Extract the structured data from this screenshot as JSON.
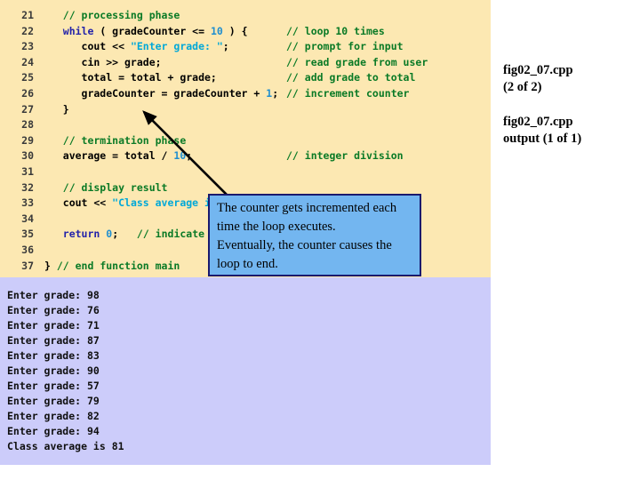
{
  "colors": {
    "code_background": "#fce8b2",
    "output_background": "#ccccfa",
    "callout_background": "#73b6f0",
    "callout_border": "#1a1a6e",
    "comment": "#0a7a26",
    "keyword": "#2222aa",
    "string": "#00a8d8",
    "number": "#1f8ecf",
    "line_number": "#3a3a3a",
    "code_text": "#000000"
  },
  "code_panel": {
    "lines": [
      {
        "no": "21",
        "indent": 0,
        "segments": [
          {
            "t": "   // processing phase",
            "c": "cmt"
          }
        ]
      },
      {
        "no": "22",
        "indent": 0,
        "segments": [
          {
            "t": "   ",
            "c": ""
          },
          {
            "t": "while",
            "c": "kw"
          },
          {
            "t": " ( gradeCounter <= ",
            "c": ""
          },
          {
            "t": "10",
            "c": "num"
          },
          {
            "t": " ) {",
            "c": ""
          }
        ]
      },
      {
        "no": "23",
        "indent": 0,
        "segments": [
          {
            "t": "      cout << ",
            "c": ""
          },
          {
            "t": "\"Enter grade: \"",
            "c": "str"
          },
          {
            "t": ";",
            "c": ""
          }
        ]
      },
      {
        "no": "24",
        "indent": 0,
        "segments": [
          {
            "t": "      cin >> grade;",
            "c": ""
          }
        ]
      },
      {
        "no": "25",
        "indent": 0,
        "segments": [
          {
            "t": "      total = total + grade;",
            "c": ""
          }
        ]
      },
      {
        "no": "26",
        "indent": 0,
        "segments": [
          {
            "t": "      gradeCounter = gradeCounter + ",
            "c": ""
          },
          {
            "t": "1",
            "c": "num"
          },
          {
            "t": ";",
            "c": ""
          }
        ]
      },
      {
        "no": "27",
        "indent": 0,
        "segments": [
          {
            "t": "   }",
            "c": ""
          }
        ]
      },
      {
        "no": "28",
        "indent": 0,
        "segments": [
          {
            "t": "",
            "c": ""
          }
        ]
      },
      {
        "no": "29",
        "indent": 0,
        "segments": [
          {
            "t": "   // termination phase",
            "c": "cmt"
          }
        ]
      },
      {
        "no": "30",
        "indent": 0,
        "segments": [
          {
            "t": "   average = total / ",
            "c": ""
          },
          {
            "t": "10",
            "c": "num"
          },
          {
            "t": ";",
            "c": ""
          }
        ]
      },
      {
        "no": "31",
        "indent": 0,
        "segments": [
          {
            "t": "",
            "c": ""
          }
        ]
      },
      {
        "no": "32",
        "indent": 0,
        "segments": [
          {
            "t": "   // display result",
            "c": "cmt"
          }
        ]
      },
      {
        "no": "33",
        "indent": 0,
        "segments": [
          {
            "t": "   cout << ",
            "c": ""
          },
          {
            "t": "\"Class average is\"",
            "c": "str"
          }
        ]
      },
      {
        "no": "34",
        "indent": 0,
        "segments": [
          {
            "t": "",
            "c": ""
          }
        ]
      },
      {
        "no": "35",
        "indent": 0,
        "segments": [
          {
            "t": "   ",
            "c": ""
          },
          {
            "t": "return",
            "c": "kw"
          },
          {
            "t": " ",
            "c": ""
          },
          {
            "t": "0",
            "c": "num"
          },
          {
            "t": ";",
            "c": ""
          },
          {
            "t": "   // indicate p",
            "c": "cmt"
          }
        ]
      },
      {
        "no": "36",
        "indent": 0,
        "segments": [
          {
            "t": "",
            "c": ""
          }
        ]
      },
      {
        "no": "37",
        "indent": 0,
        "segments": [
          {
            "t": "} ",
            "c": ""
          },
          {
            "t": "// end function main",
            "c": "cmt"
          }
        ]
      }
    ],
    "right_comments": [
      {
        "text": "// loop 10 times",
        "line_index": 1
      },
      {
        "text": "// prompt for input",
        "line_index": 2
      },
      {
        "text": "// read grade from user",
        "line_index": 3
      },
      {
        "text": "// add grade to total",
        "line_index": 4
      },
      {
        "text": "// increment counter",
        "line_index": 5
      },
      {
        "text": "// integer division",
        "line_index": 9
      }
    ]
  },
  "callout": {
    "lines": [
      "The counter gets incremented each",
      "time the loop executes.",
      "Eventually, the counter causes the",
      "loop to end."
    ]
  },
  "output_panel": {
    "lines": [
      "Enter grade: 98",
      "Enter grade: 76",
      "Enter grade: 71",
      "Enter grade: 87",
      "Enter grade: 83",
      "Enter grade: 90",
      "Enter grade: 57",
      "Enter grade: 79",
      "Enter grade: 82",
      "Enter grade: 94",
      "Class average is 81"
    ]
  },
  "captions": {
    "code": "fig02_07.cpp\n(2 of 2)",
    "output": "fig02_07.cpp\noutput (1 of 1)"
  }
}
